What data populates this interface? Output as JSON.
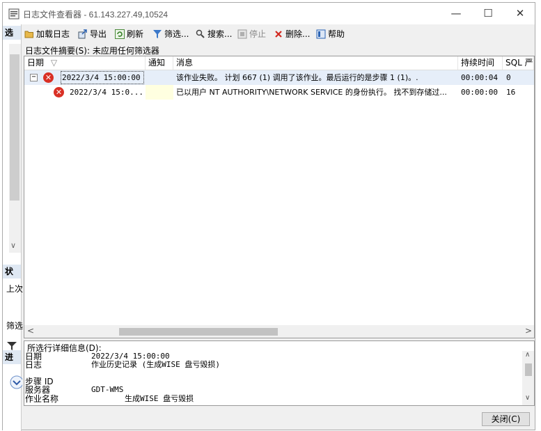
{
  "window": {
    "title": "日志文件查看器 - 61.143.227.49,10524",
    "minimize_glyph": "—",
    "maximize_glyph": "☐",
    "close_glyph": "✕"
  },
  "side_panel": {
    "select_header": "选",
    "status_header": "状",
    "last_label": "上次",
    "filter_label": "筛选",
    "progress_header": "进",
    "scroll_down_glyph": "∨"
  },
  "toolbar": {
    "load_log": "加载日志",
    "export": "导出",
    "refresh": "刷新",
    "filter": "筛选...",
    "search": "搜索...",
    "stop": "停止",
    "delete": "删除...",
    "help": "帮助"
  },
  "summary": "日志文件摘要(S): 未应用任何筛选器",
  "grid": {
    "columns": [
      "日期",
      "通知",
      "消息",
      "持续时间",
      "SQL 严重"
    ],
    "rows": [
      {
        "date": "2022/3/4 15:00:00",
        "notify": "",
        "message": "该作业失败。  计划 667 (1) 调用了该作业。最后运行的是步骤 1 (1)。.",
        "duration": "00:00:04",
        "severity": "0",
        "expander": "−"
      },
      {
        "date": "2022/3/4 15:0...",
        "notify": "",
        "message": "已以用户 NT AUTHORITY\\NETWORK SERVICE 的身份执行。 找不到存储过...",
        "duration": "00:00:00",
        "severity": "16"
      }
    ],
    "sort_glyph": "▽",
    "scroll_left_glyph": "<",
    "scroll_right_glyph": ">"
  },
  "details": {
    "label": "所选行详细信息(D):",
    "fields": [
      {
        "key": "日期",
        "value": "2022/3/4 15:00:00"
      },
      {
        "key": "日志",
        "value": "作业历史记录 (生成WISE 盘亏毁损)"
      },
      {
        "key": "步骤 ID",
        "value": ""
      },
      {
        "key": "服务器",
        "value": "GDT-WMS"
      },
      {
        "key": "作业名称",
        "value": "生成WISE 盘亏毁损"
      }
    ],
    "scroll_up_glyph": "∧",
    "scroll_down_glyph": "∨"
  },
  "close_button": "关闭(C)",
  "colors": {
    "error": "#d93025",
    "selected_row": "#e6eef9",
    "header_bar": "#dfe8f3"
  }
}
